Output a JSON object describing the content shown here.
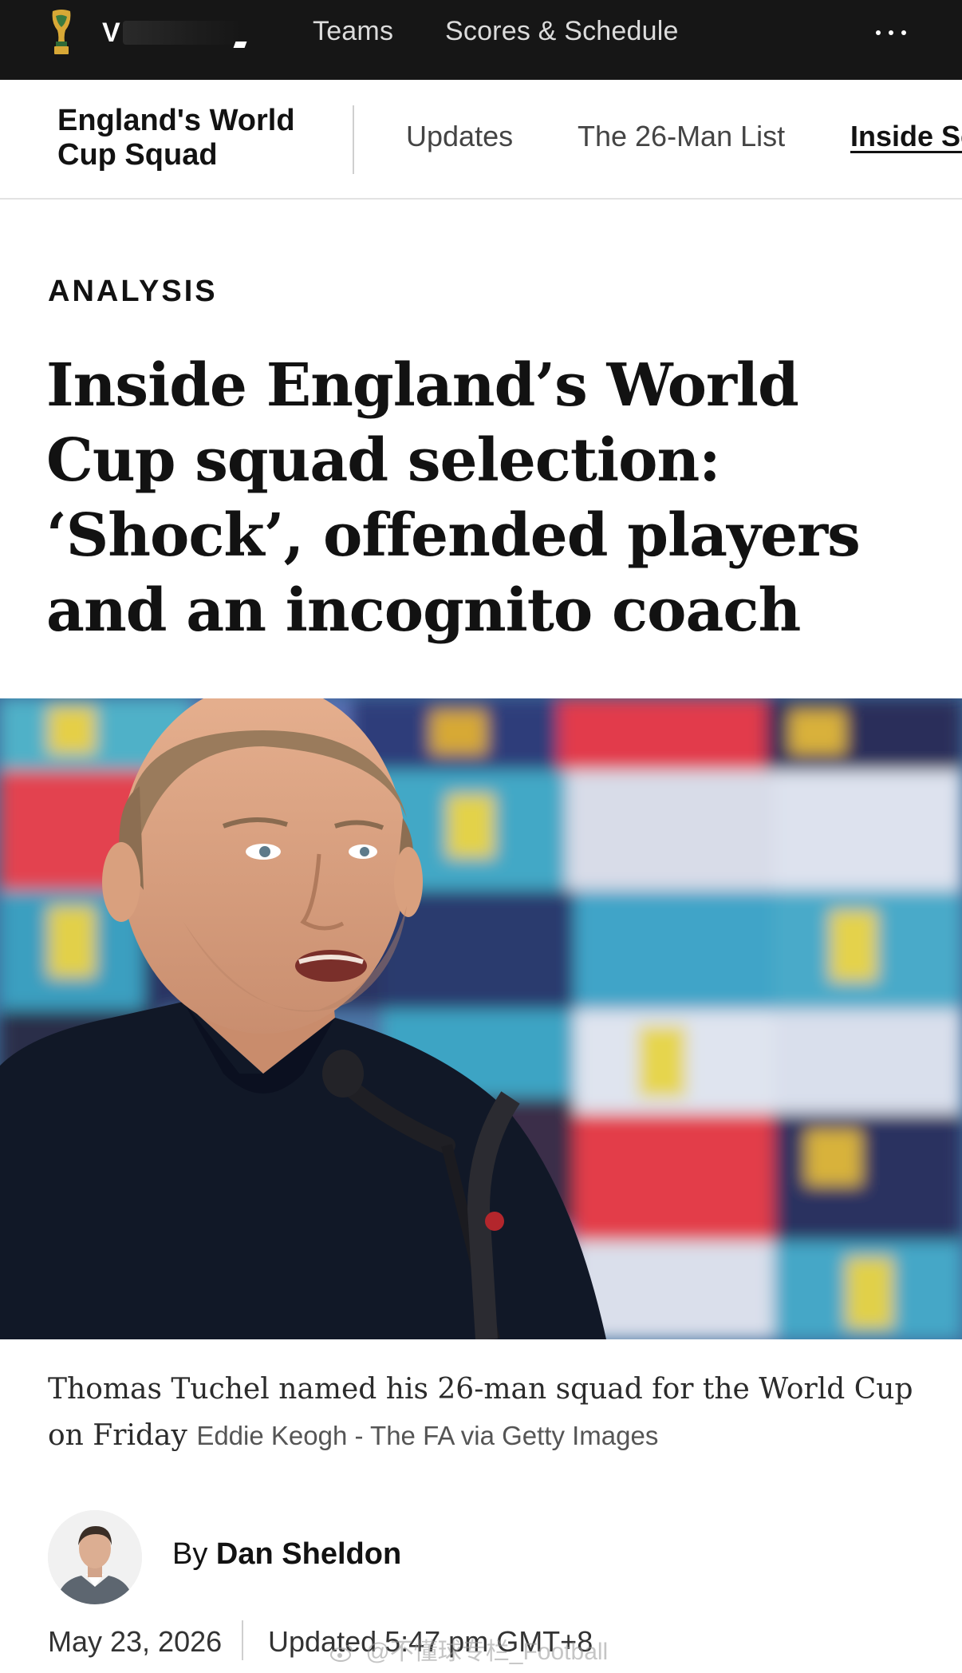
{
  "topbar": {
    "brand_initial": "V",
    "nav": [
      "Teams",
      "Scores & Schedule"
    ]
  },
  "subnav": {
    "section_title": "England's World Cup Squad",
    "tabs": [
      "Updates",
      "The 26-Man List",
      "Inside Sc"
    ]
  },
  "article": {
    "kicker": "ANALYSIS",
    "headline": "Inside England’s World Cup squad selection: ‘Shock’, offended players and an incognito coach",
    "caption": "Thomas Tuchel named his 26-man squad for the World Cup on Friday",
    "credit": "Eddie Keogh - The FA via Getty Images",
    "byline_prefix": "By",
    "author": "Dan Sheldon",
    "date": "May 23, 2026",
    "updated": "Updated 5:47 pm GMT+8"
  },
  "watermark": "@不懂球专栏_Football",
  "colors": {
    "topbar_bg": "#161616",
    "text": "#121212",
    "divider": "#e2e2e2"
  },
  "icons": {
    "logo": "world-cup-trophy-icon",
    "more": "more-dots-icon",
    "watermark": "weibo-icon"
  }
}
